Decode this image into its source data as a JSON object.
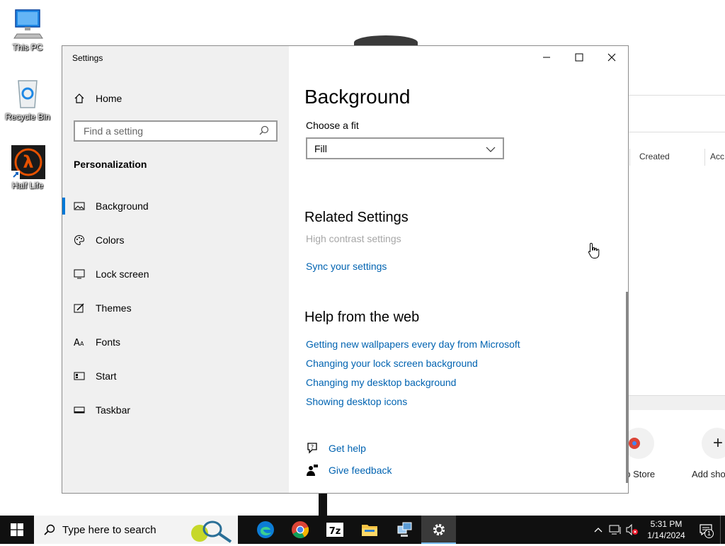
{
  "desktop": {
    "icons": [
      {
        "label": "This PC"
      },
      {
        "label": "Recycle Bin"
      },
      {
        "label": "Half Life"
      }
    ]
  },
  "background_window": {
    "columns": [
      "Created",
      "Acc"
    ],
    "tiles": [
      {
        "label": "eb Store"
      },
      {
        "label": "Add sho"
      }
    ]
  },
  "settings": {
    "window_title": "Settings",
    "home_label": "Home",
    "search_placeholder": "Find a setting",
    "section_title": "Personalization",
    "nav_items": [
      {
        "label": "Background",
        "icon": "picture-icon",
        "active": true
      },
      {
        "label": "Colors",
        "icon": "palette-icon"
      },
      {
        "label": "Lock screen",
        "icon": "lock-screen-icon"
      },
      {
        "label": "Themes",
        "icon": "themes-icon"
      },
      {
        "label": "Fonts",
        "icon": "fonts-icon"
      },
      {
        "label": "Start",
        "icon": "start-icon"
      },
      {
        "label": "Taskbar",
        "icon": "taskbar-icon"
      }
    ],
    "page_title": "Background",
    "fit_label": "Choose a fit",
    "fit_value": "Fill",
    "related_title": "Related Settings",
    "related_links": [
      {
        "label": "High contrast settings",
        "disabled": true
      },
      {
        "label": "Sync your settings"
      }
    ],
    "help_title": "Help from the web",
    "help_links": [
      "Getting new wallpapers every day from Microsoft",
      "Changing your lock screen background",
      "Changing my desktop background",
      "Showing desktop icons"
    ],
    "get_help": "Get help",
    "give_feedback": "Give feedback"
  },
  "taskbar": {
    "search_placeholder": "Type here to search",
    "apps": [
      "edge-icon",
      "chrome-icon",
      "7zip-icon",
      "file-explorer-icon",
      "network-app-icon",
      "settings-icon"
    ],
    "time": "5:31 PM",
    "date": "1/14/2024",
    "notification_count": "1"
  },
  "colors": {
    "accent": "#0078d7",
    "link": "#0063b1",
    "sidebar_bg": "#f0f0f0",
    "taskbar_bg": "#101010"
  }
}
